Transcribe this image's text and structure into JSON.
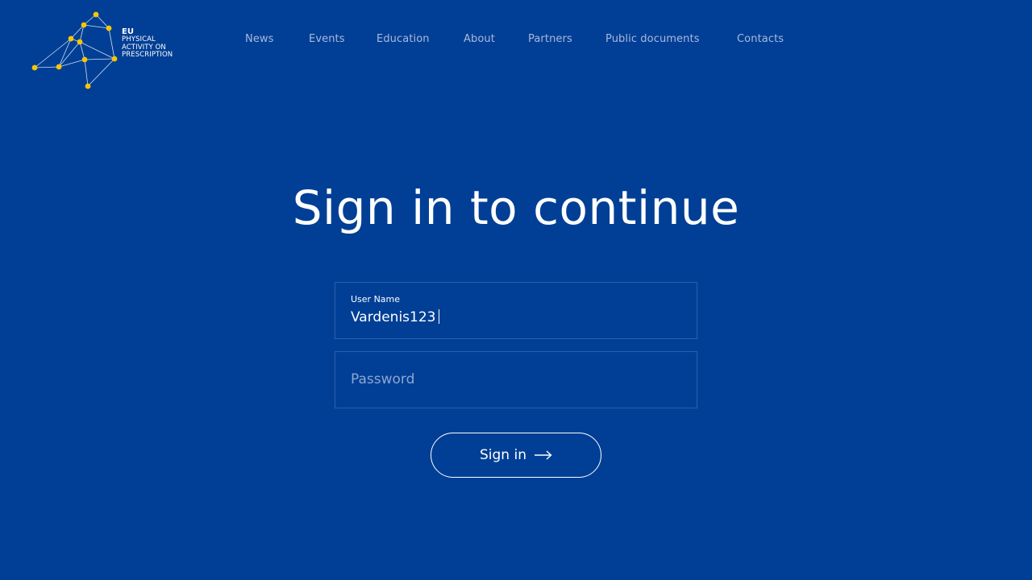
{
  "logo": {
    "line1": "EU",
    "line2": "PHYSICAL",
    "line3": "ACTIVITY ON",
    "line4": "PRESCRIPTION",
    "dot_color": "#f7c600"
  },
  "nav": {
    "items": [
      {
        "label": "News"
      },
      {
        "label": "Events"
      },
      {
        "label": "Education"
      },
      {
        "label": "About"
      },
      {
        "label": "Partners"
      },
      {
        "label": "Public documents"
      },
      {
        "label": "Contacts"
      }
    ]
  },
  "main": {
    "title": "Sign in to continue",
    "username": {
      "label": "User Name",
      "value": "Vardenis123"
    },
    "password": {
      "placeholder": "Password"
    },
    "signin_label": "Sign in",
    "arrow_icon": "arrow-right-icon"
  },
  "colors": {
    "background": "#003f95",
    "accent": "#f7c600",
    "nav_text": "#a9b9dc",
    "field_border": "#2c5fae"
  }
}
